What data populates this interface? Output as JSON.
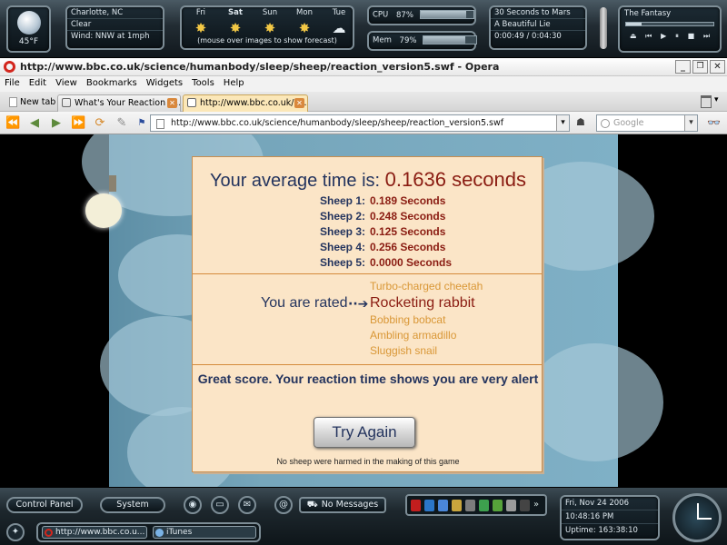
{
  "widgets": {
    "weather": {
      "temp": "45°F",
      "city": "Charlotte, NC",
      "condition": "Clear",
      "wind": "Wind: NNW at 1mph"
    },
    "forecast": {
      "days": [
        "Fri",
        "Sat",
        "Sun",
        "Mon",
        "Tue"
      ],
      "note": "(mouse over images to show forecast)"
    },
    "system": {
      "cpu_label": "CPU",
      "cpu_value": "87%",
      "cpu_fraction": 0.87,
      "mem_label": "Mem",
      "mem_value": "79%",
      "mem_fraction": 0.79
    },
    "music": {
      "artist": "30 Seconds to Mars",
      "track": "A Beautiful Lie",
      "time": "0:00:49 / 0:04:30"
    },
    "player": {
      "title": "The Fantasy",
      "progress_fraction": 0.18
    }
  },
  "browser": {
    "title": "http://www.bbc.co.uk/science/humanbody/sleep/sheep/reaction_version5.swf - Opera",
    "menu": [
      "File",
      "Edit",
      "View",
      "Bookmarks",
      "Widgets",
      "Tools",
      "Help"
    ],
    "tabs": [
      {
        "label": "New tab"
      },
      {
        "label": "What's Your Reaction Ti..."
      },
      {
        "label": "http://www.bbc.co.uk/s..."
      }
    ],
    "address": "http://www.bbc.co.uk/science/humanbody/sleep/sheep/reaction_version5.swf",
    "search_placeholder": "Google"
  },
  "game": {
    "average_label": "Your average time is:",
    "average_value": "0.1636 seconds",
    "sheep": [
      {
        "label": "Sheep 1:",
        "value": "0.189 Seconds"
      },
      {
        "label": "Sheep 2:",
        "value": "0.248 Seconds"
      },
      {
        "label": "Sheep 3:",
        "value": "0.125 Seconds"
      },
      {
        "label": "Sheep 4:",
        "value": "0.256 Seconds"
      },
      {
        "label": "Sheep 5:",
        "value": "0.0000 Seconds"
      }
    ],
    "rated_label": "You are rated",
    "ratings": [
      "Turbo-charged cheetah",
      "Rocketing rabbit",
      "Bobbing bobcat",
      "Ambling armadillo",
      "Sluggish snail"
    ],
    "current_rating": "Rocketing rabbit",
    "score_message": "Great score. Your reaction time shows you are very alert",
    "try_again": "Try Again",
    "disclaimer": "No sheep were harmed in the making of this game"
  },
  "taskbar": {
    "control_panel": "Control Panel",
    "system": "System",
    "messages": "No Messages",
    "date": "Fri, Nov 24 2006",
    "time": "10:48:16 PM",
    "uptime": "Uptime: 163:38:10",
    "tasks": [
      {
        "label": "http://www.bbc.co.u..."
      },
      {
        "label": "iTunes"
      }
    ]
  },
  "colors": {
    "accent_red": "#8a1c12",
    "navy": "#24345e",
    "rating_orange": "#d99736",
    "dialog_bg": "#fbe5c7"
  }
}
